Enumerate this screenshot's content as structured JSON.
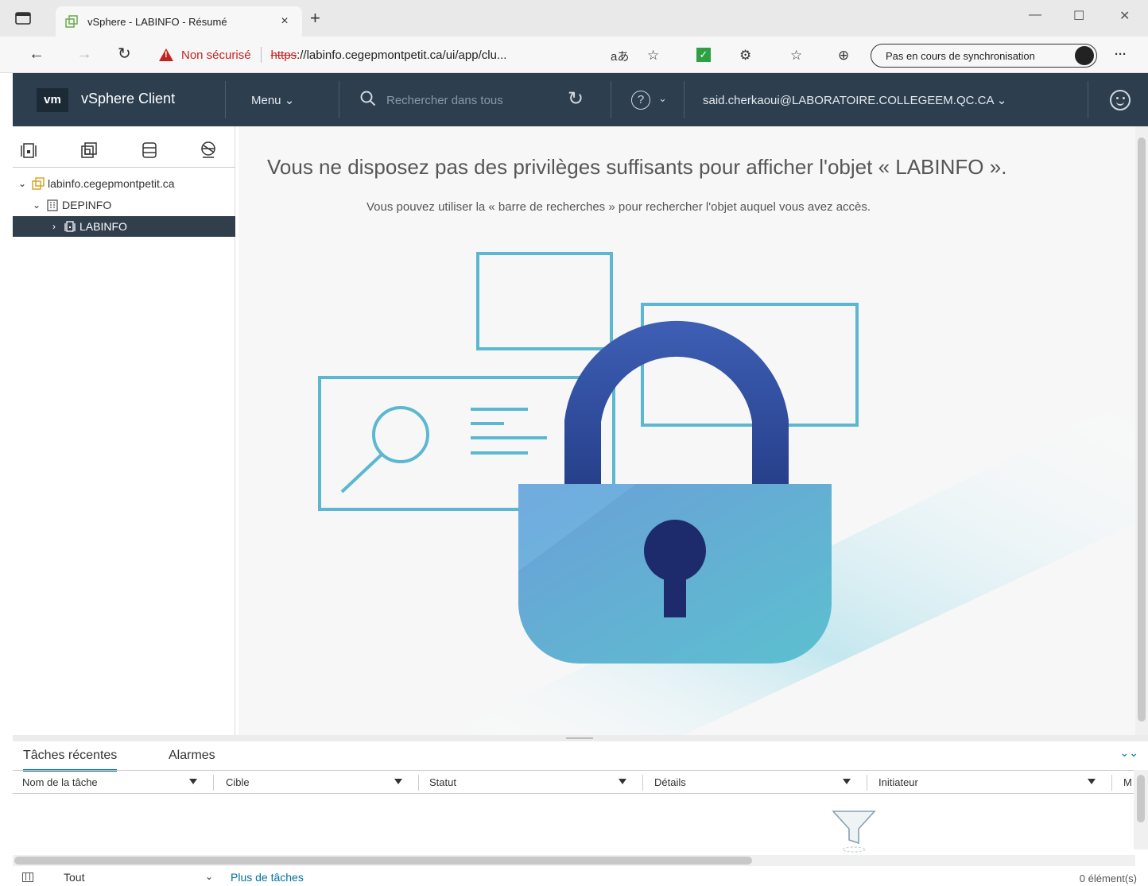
{
  "browser": {
    "tab_title": "vSphere - LABINFO - Résumé",
    "tab_close": "×",
    "new_tab": "+",
    "security_label": "Non sécurisé",
    "url_scheme": "https",
    "url_rest": "://labinfo.cegepmontpetit.ca/ui/app/clu...",
    "read_aloud": "aあ",
    "sync_label": "Pas en cours de synchronisation",
    "more": "···",
    "window_min": "—",
    "window_max": "☐",
    "window_close": "✕"
  },
  "header": {
    "logo": "vm",
    "app_title": "vSphere Client",
    "menu_label": "Menu ⌄",
    "search_placeholder": "Rechercher dans tous",
    "user": "said.cherkaoui@LABORATOIRE.COLLEGEEM.QC.CA ⌄"
  },
  "tree": {
    "items": [
      {
        "label": "labinfo.cegepmontpetit.ca",
        "chevron": "⌄"
      },
      {
        "label": "DEPINFO",
        "chevron": "⌄"
      },
      {
        "label": "LABINFO",
        "chevron": "›"
      }
    ]
  },
  "main": {
    "title": "Vous ne disposez pas des privilèges suffisants pour afficher l'objet « LABINFO ».",
    "subtitle": "Vous pouvez utiliser la « barre de recherches » pour rechercher l'objet auquel vous avez accès."
  },
  "tasks": {
    "tabs": [
      "Tâches récentes",
      "Alarmes"
    ],
    "columns": [
      "Nom de la tâche",
      "Cible",
      "Statut",
      "Détails",
      "Initiateur",
      "M"
    ],
    "footer_select": "Tout",
    "more_tasks": "Plus de tâches",
    "count": "0 élément(s)"
  },
  "colors": {
    "header_bg": "#2d3e4e",
    "accent": "#0072a3",
    "selected_row": "#313e4c",
    "illustration_outline": "#5bb8d0",
    "lock_shackle": "#2f4a9a"
  }
}
